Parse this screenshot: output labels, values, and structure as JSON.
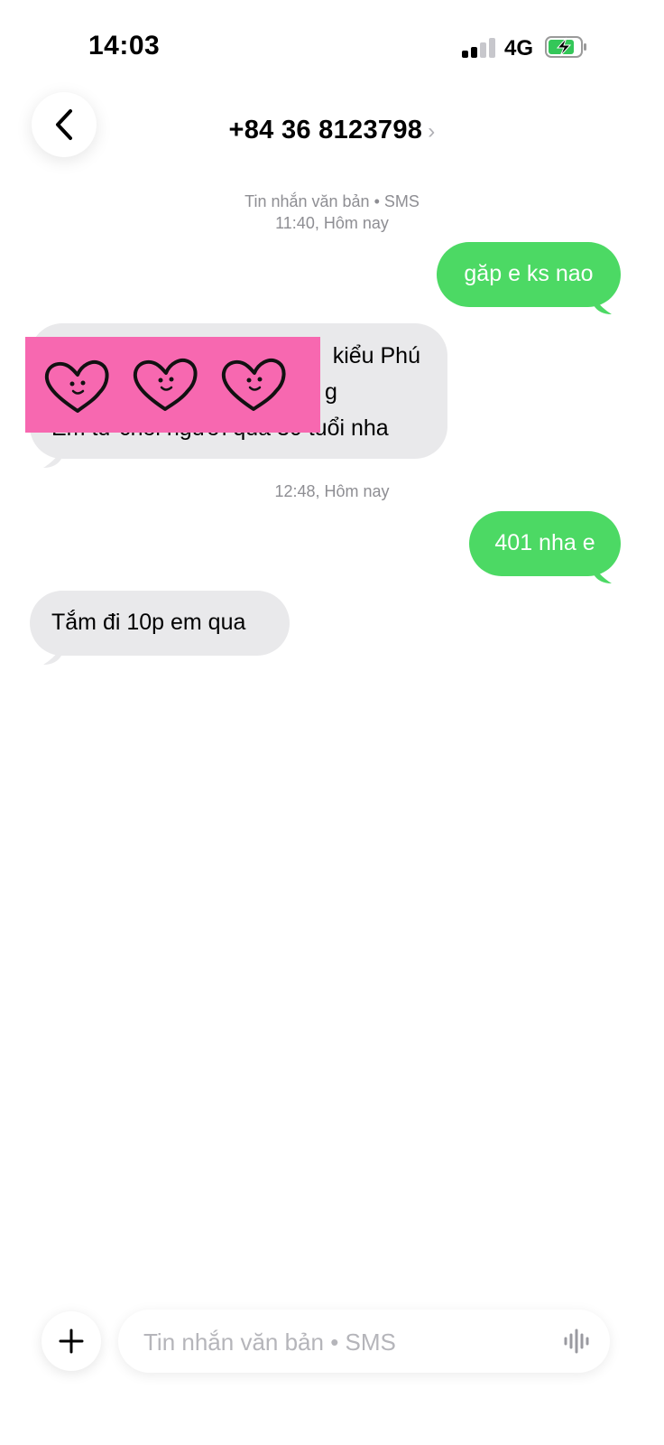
{
  "status_bar": {
    "time": "14:03",
    "network": "4G"
  },
  "header": {
    "contact": "+84 36 8123798"
  },
  "thread": {
    "meta1_line1": "Tin nhắn văn bản • SMS",
    "meta1_line2": "11:40, Hôm nay",
    "msg_out_1": "găp e ks nao",
    "msg_in_1_line1": "kiểu Phú",
    "msg_in_1_line2": "g",
    "msg_in_1_line3": "Em từ chối người quá 30 tuổi nha",
    "meta2": "12:48, Hôm nay",
    "msg_out_2": "401 nha e",
    "msg_in_2": "Tắm đi 10p em qua"
  },
  "composer": {
    "placeholder": "Tin nhắn văn bản • SMS"
  },
  "colors": {
    "outgoing": "#4cd964",
    "incoming": "#e9e9eb",
    "censor": "#f768b0"
  }
}
